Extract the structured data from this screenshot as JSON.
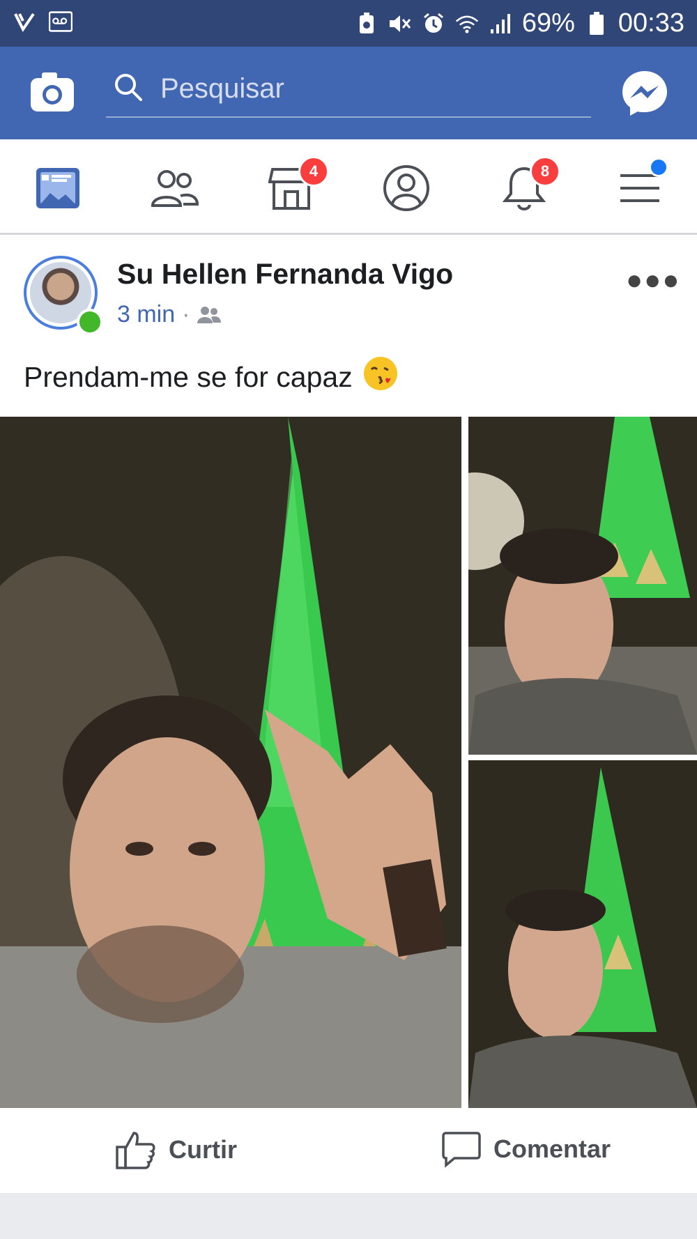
{
  "status_bar": {
    "battery_percent": "69%",
    "time": "00:33",
    "icons": [
      "video-icon",
      "voicemail-icon",
      "recycle-icon",
      "mute-icon",
      "alarm-icon",
      "wifi-icon",
      "signal-icon",
      "battery-icon"
    ]
  },
  "app_bar": {
    "search_placeholder": "Pesquisar",
    "icons": [
      "camera-icon",
      "search-icon",
      "messenger-icon"
    ]
  },
  "nav_tabs": [
    {
      "name": "news-feed",
      "icon": "news-feed-icon",
      "badge": ""
    },
    {
      "name": "friends",
      "icon": "friends-icon",
      "badge": ""
    },
    {
      "name": "marketplace",
      "icon": "marketplace-icon",
      "badge": "4"
    },
    {
      "name": "profile",
      "icon": "profile-icon",
      "badge": ""
    },
    {
      "name": "notifications",
      "icon": "bell-icon",
      "badge": "8"
    },
    {
      "name": "menu",
      "icon": "menu-icon",
      "badge": ""
    }
  ],
  "post": {
    "author": "Su Hellen Fernanda Vigo",
    "time": "3 min",
    "separator": "·",
    "privacy_icon": "friends-audience-icon",
    "caption": "Prendam-me se for capaz",
    "caption_emoji": "😘",
    "photos_count": 3
  },
  "actions": {
    "like": "Curtir",
    "comment": "Comentar"
  },
  "colors": {
    "status_bar": "#2f4677",
    "app_bar": "#4267b2",
    "badge": "#fa3e3e",
    "link_blue": "#4267b2",
    "online_green": "#42b72a",
    "spire_green": "#3ed65a"
  }
}
